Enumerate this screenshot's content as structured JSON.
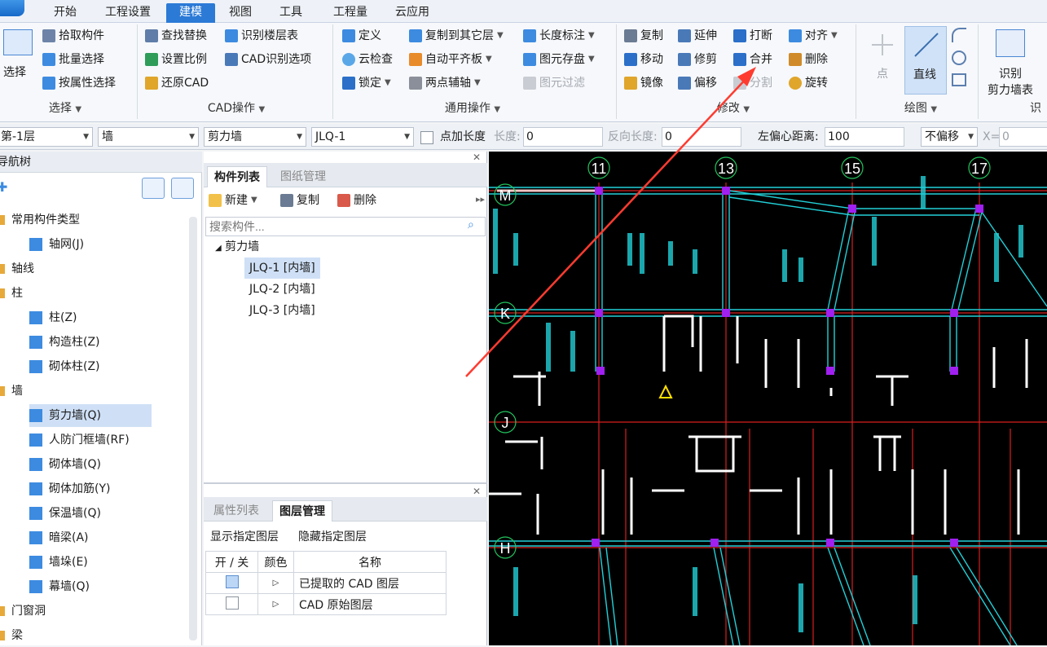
{
  "menu": {
    "tabs": [
      "开始",
      "工程设置",
      "建模",
      "视图",
      "工具",
      "工程量",
      "云应用"
    ],
    "active": "建模"
  },
  "ribbon": {
    "select": {
      "big": "选择",
      "items": [
        "拾取构件",
        "批量选择",
        "按属性选择"
      ],
      "label": "选择"
    },
    "cad": {
      "items": [
        "查找替换",
        "识别楼层表",
        "设置比例",
        "CAD识别选项",
        "还原CAD"
      ],
      "label": "CAD操作"
    },
    "common": {
      "items": [
        "定义",
        "复制到其它层",
        "长度标注",
        "云检查",
        "自动平齐板",
        "图元存盘",
        "锁定",
        "两点辅轴",
        "图元过滤"
      ],
      "label": "通用操作"
    },
    "modify": {
      "items": [
        "复制",
        "延伸",
        "打断",
        "对齐",
        "移动",
        "修剪",
        "合并",
        "删除",
        "镜像",
        "偏移",
        "分割",
        "旋转"
      ],
      "label": "修改"
    },
    "draw": {
      "items": [
        "点",
        "直线"
      ],
      "label": "绘图"
    },
    "identify": {
      "big": "识别",
      "big2": "剪力墙表",
      "label": "识"
    }
  },
  "propbar": {
    "floor": "第-1层",
    "category": "墙",
    "type": "剪力墙",
    "component": "JLQ-1",
    "add_length_label": "点加长度",
    "length_label": "长度:",
    "length_value": "0",
    "reverse_label": "反向长度:",
    "reverse_value": "0",
    "left_offset_label": "左偏心距离:",
    "left_offset_value": "100",
    "offset_mode": "不偏移",
    "x_label": "X=",
    "x_value": "0"
  },
  "nav": {
    "title": "导航树",
    "items": [
      {
        "label": "常用构件类型",
        "level": 0
      },
      {
        "label": "轴网(J)",
        "level": 1
      },
      {
        "label": "轴线",
        "level": 0
      },
      {
        "label": "柱",
        "level": 0
      },
      {
        "label": "柱(Z)",
        "level": 1
      },
      {
        "label": "构造柱(Z)",
        "level": 1
      },
      {
        "label": "砌体柱(Z)",
        "level": 1
      },
      {
        "label": "墙",
        "level": 0
      },
      {
        "label": "剪力墙(Q)",
        "level": 1,
        "selected": true
      },
      {
        "label": "人防门框墙(RF)",
        "level": 1
      },
      {
        "label": "砌体墙(Q)",
        "level": 1
      },
      {
        "label": "砌体加筋(Y)",
        "level": 1
      },
      {
        "label": "保温墙(Q)",
        "level": 1
      },
      {
        "label": "暗梁(A)",
        "level": 1
      },
      {
        "label": "墙垛(E)",
        "level": 1
      },
      {
        "label": "幕墙(Q)",
        "level": 1
      },
      {
        "label": "门窗洞",
        "level": 0
      },
      {
        "label": "梁",
        "level": 0
      }
    ]
  },
  "components": {
    "tabs": [
      "构件列表",
      "图纸管理"
    ],
    "toolbar": {
      "new": "新建",
      "copy": "复制",
      "delete": "删除"
    },
    "search_placeholder": "搜索构件...",
    "group": "剪力墙",
    "items": [
      "JLQ-1 [内墙]",
      "JLQ-2 [内墙]",
      "JLQ-3 [内墙]"
    ]
  },
  "layers": {
    "tabs": [
      "属性列表",
      "图层管理"
    ],
    "show": "显示指定图层",
    "hide": "隐藏指定图层",
    "columns": [
      "开 / 关",
      "颜色",
      "名称"
    ],
    "rows": [
      {
        "on": true,
        "name": "已提取的 CAD 图层"
      },
      {
        "on": false,
        "name": "CAD 原始图层"
      }
    ]
  },
  "canvas": {
    "axes_top": [
      "11",
      "13",
      "15",
      "17"
    ],
    "axes_left": [
      "M",
      "K",
      "J",
      "H"
    ]
  },
  "colors": {
    "accent": "#2b7ad6",
    "arrow": "#ff3b30",
    "axis_red": "#d91f1f",
    "wall_cyan": "#22d0d8",
    "node": "#a020f0"
  }
}
